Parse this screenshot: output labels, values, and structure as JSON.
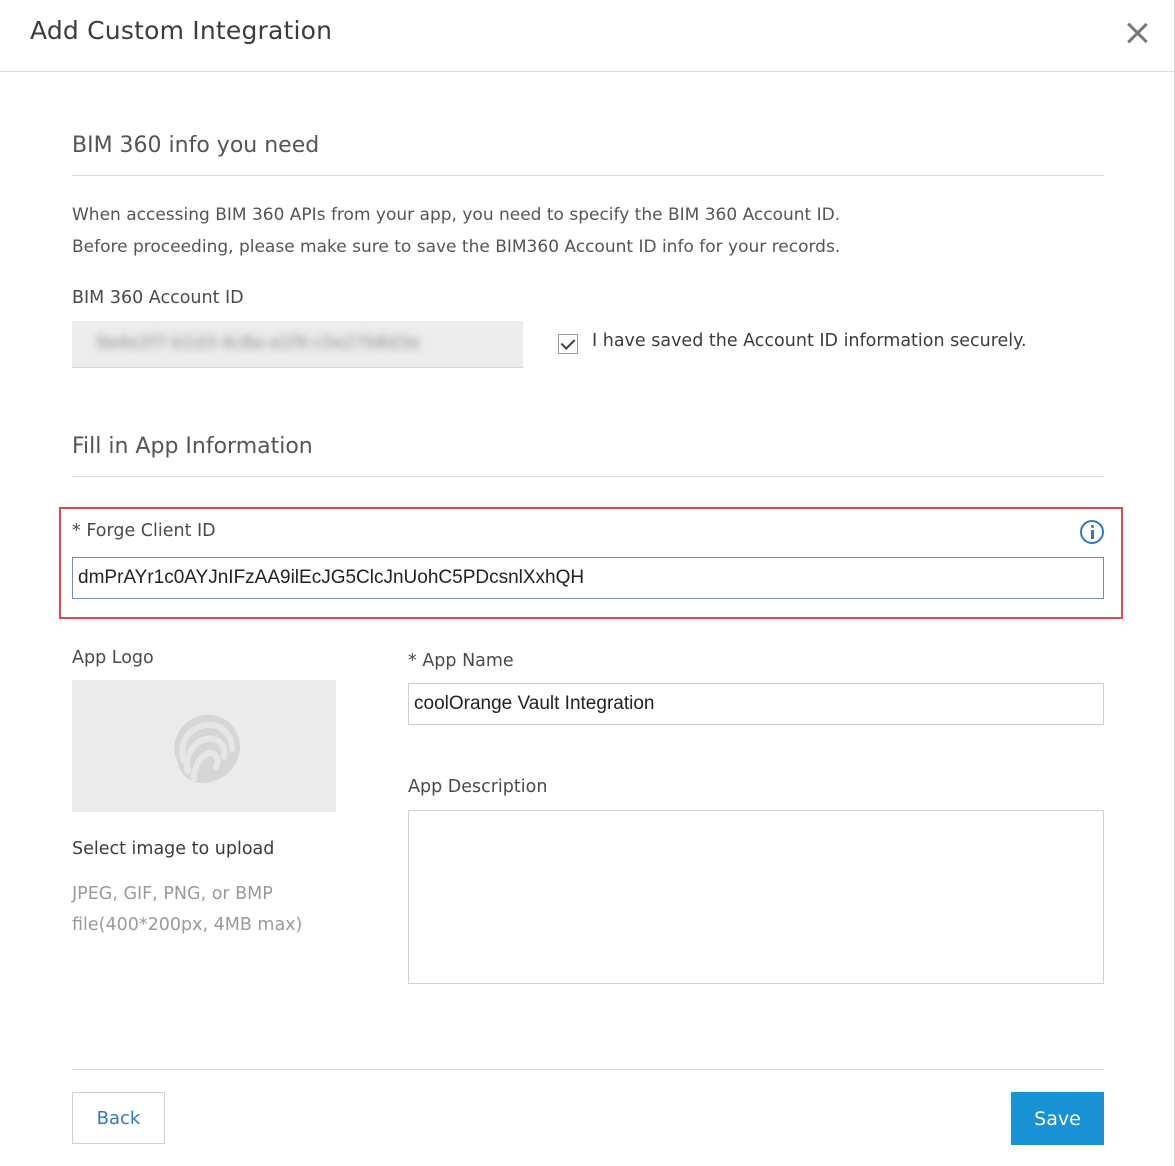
{
  "dialog": {
    "title": "Add Custom Integration"
  },
  "bim_section": {
    "heading": "BIM 360 info you need",
    "description_line1": "When accessing BIM 360 APIs from your app, you need to specify the BIM 360 Account ID.",
    "description_line2": "Before proceeding, please make sure to save the BIM360 Account ID info for your records.",
    "account_id_label": "BIM 360 Account ID",
    "account_id_value": "9a4e2f7-b1d3-4c8a-a1f9-c5e27b8d3a",
    "saved_checkbox_label": "I have saved the Account ID information securely.",
    "saved_checked": true
  },
  "app_section": {
    "heading": "Fill in App Information",
    "client_id_label": "* Forge Client ID",
    "client_id_value": "dmPrAYr1c0AYJnIFzAA9ilEcJG5ClcJnUohC5PDcsnlXxhQH",
    "app_logo_label": "App Logo",
    "upload_label": "Select image to upload",
    "upload_hint": "JPEG, GIF, PNG, or BMP file(400*200px, 4MB max)",
    "app_name_label": "* App Name",
    "app_name_value": "coolOrange Vault Integration",
    "app_description_label": "App Description",
    "app_description_value": ""
  },
  "footer": {
    "back_label": "Back",
    "save_label": "Save"
  },
  "colors": {
    "accent": "#1892d4",
    "highlight": "#e5464d",
    "info": "#2f78c8"
  },
  "icons": [
    "close-icon",
    "info-icon",
    "checkmark-icon",
    "placeholder-logo-icon"
  ]
}
